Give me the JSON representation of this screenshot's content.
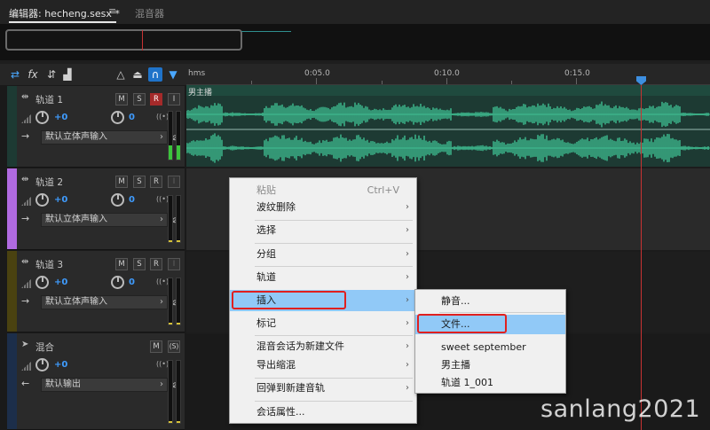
{
  "tabs": {
    "editor": "编辑器: hecheng.sesx *",
    "menu_icon": "≡",
    "mixer": "混音器"
  },
  "ruler": {
    "unit": "hms",
    "labels": [
      "0:05.0",
      "0:10.0",
      "0:15.0"
    ]
  },
  "tracks": [
    {
      "name": "轨道 1",
      "volume": "+0",
      "pan": "0",
      "input": "默认立体声输入",
      "color": "#1d3a33",
      "buttons": [
        "M",
        "S",
        "R",
        "I"
      ]
    },
    {
      "name": "轨道 2",
      "volume": "+0",
      "pan": "0",
      "input": "默认立体声输入",
      "color": "#b06ae0",
      "buttons": [
        "M",
        "S",
        "R",
        "I"
      ]
    },
    {
      "name": "轨道 3",
      "volume": "+0",
      "pan": "0",
      "input": "默认立体声输入",
      "color": "#4a4210",
      "buttons": [
        "M",
        "S",
        "R",
        "I"
      ]
    },
    {
      "name": "混合",
      "volume": "+0",
      "input": "默认输出",
      "color": "#1c2e4a",
      "buttons": [
        "M",
        "(S)"
      ]
    }
  ],
  "clip": {
    "label": "男主播"
  },
  "context_menu": {
    "items": [
      {
        "label": "粘贴",
        "shortcut": "Ctrl+V",
        "disabled": true
      },
      {
        "label": "波纹删除",
        "submenu": true
      },
      {
        "label": "选择",
        "submenu": true
      },
      {
        "label": "分组",
        "submenu": true
      },
      {
        "label": "轨道",
        "submenu": true
      },
      {
        "label": "插入",
        "submenu": true,
        "highlighted": true
      },
      {
        "label": "标记",
        "submenu": true
      },
      {
        "label": "混音会话为新建文件",
        "submenu": true
      },
      {
        "label": "导出缩混",
        "submenu": true
      },
      {
        "label": "回弹到新建音轨",
        "submenu": true
      },
      {
        "label": "会话属性..."
      }
    ]
  },
  "insert_submenu": {
    "items": [
      {
        "label": "静音..."
      },
      {
        "label": "文件...",
        "highlighted": true
      },
      {
        "label": "sweet september"
      },
      {
        "label": "男主播"
      },
      {
        "label": "轨道 1_001"
      }
    ]
  },
  "watermark": "sanlang2021",
  "colors": {
    "accent": "#3d8fe0",
    "playhead": "#c83232",
    "highlight": "#91c9f7",
    "annotation": "#e0201f",
    "waveform": "#3fbf92"
  }
}
